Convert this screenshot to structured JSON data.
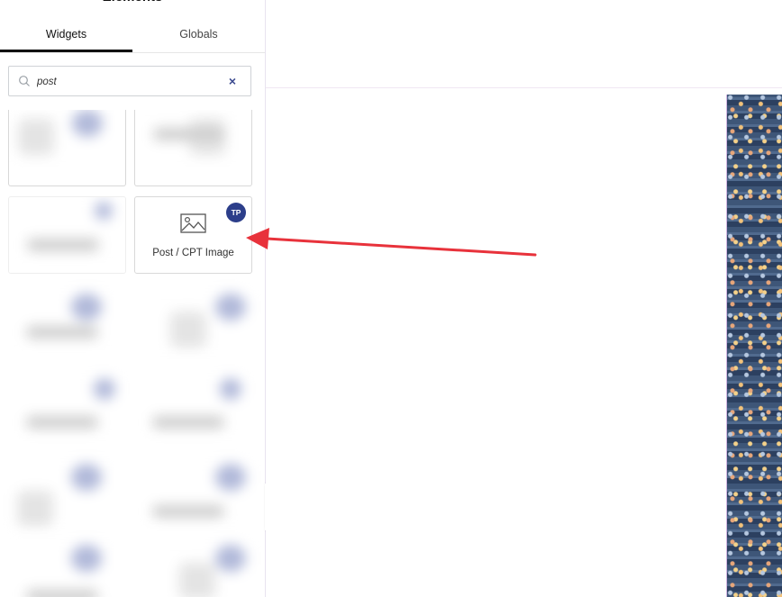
{
  "panel": {
    "title": "Elements"
  },
  "tabs": [
    {
      "label": "Widgets",
      "active": true
    },
    {
      "label": "Globals",
      "active": false
    }
  ],
  "search": {
    "value": "post",
    "icon": "search-icon",
    "clear_icon": "close-icon",
    "clear_label": "×"
  },
  "widgets": [
    {
      "label": "Post / CPT Image",
      "badge": "TP",
      "icon": "image-icon"
    }
  ],
  "collapse": {
    "label": "‹",
    "icon": "chevron-left-icon"
  },
  "colors": {
    "badge": "#2c3e8a",
    "arrow": "#e8323b",
    "tab_active_underline": "#111111"
  }
}
